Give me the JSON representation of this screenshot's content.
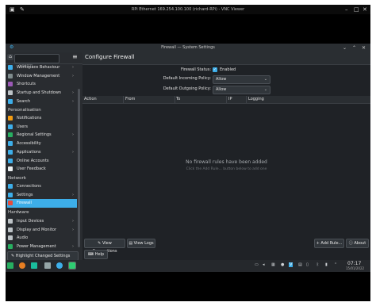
{
  "vnc": {
    "title": "RPi Ethernet 169.254.100.100 (richard-RPi) - VNC Viewer",
    "ctrl_min": "–",
    "ctrl_max": "□",
    "ctrl_close": "✕"
  },
  "window": {
    "title": "Firewall — System Settings",
    "ctrl_min": "⌄",
    "ctrl_max": "⌃",
    "ctrl_close": "✕"
  },
  "sidebar": {
    "search_placeholder": "Search...",
    "items_top": [
      {
        "label": "Workspace Behaviour",
        "chev": "›",
        "color": "#3daee9"
      },
      {
        "label": "Window Management",
        "chev": "›",
        "color": "#7f8c8d"
      },
      {
        "label": "Shortcuts",
        "chev": "",
        "color": "#9b59b6"
      },
      {
        "label": "Startup and Shutdown",
        "chev": "›",
        "color": "#bdc3c7"
      },
      {
        "label": "Search",
        "chev": "›",
        "color": "#3daee9"
      }
    ],
    "section_personalisation": "Personalisation",
    "items_personal": [
      {
        "label": "Notifications",
        "chev": "",
        "color": "#f39c12"
      },
      {
        "label": "Users",
        "chev": "",
        "color": "#3daee9"
      },
      {
        "label": "Regional Settings",
        "chev": "›",
        "color": "#27ae60"
      },
      {
        "label": "Accessibility",
        "chev": "",
        "color": "#3daee9"
      },
      {
        "label": "Applications",
        "chev": "›",
        "color": "#3daee9"
      },
      {
        "label": "Online Accounts",
        "chev": "",
        "color": "#3daee9"
      },
      {
        "label": "User Feedback",
        "chev": "",
        "color": "#ecf0f1"
      }
    ],
    "section_network": "Network",
    "items_network": [
      {
        "label": "Connections",
        "chev": "",
        "color": "#3daee9"
      },
      {
        "label": "Settings",
        "chev": "›",
        "color": "#3daee9"
      },
      {
        "label": "Firewall",
        "chev": "",
        "color": "#e74c3c"
      }
    ],
    "section_hardware": "Hardware",
    "items_hardware": [
      {
        "label": "Input Devices",
        "chev": "›",
        "color": "#bdc3c7"
      },
      {
        "label": "Display and Monitor",
        "chev": "›",
        "color": "#bdc3c7"
      },
      {
        "label": "Audio",
        "chev": "",
        "color": "#bdc3c7"
      },
      {
        "label": "Power Management",
        "chev": "›",
        "color": "#27ae60"
      }
    ],
    "highlight_label": "Highlight Changed Settings"
  },
  "main": {
    "title": "Configure Firewall",
    "status_label": "Firewall Status:",
    "status_value": "Enabled",
    "incoming_label": "Default Incoming Policy:",
    "incoming_value": "Allow",
    "outgoing_label": "Default Outgoing Policy:",
    "outgoing_value": "Allow",
    "columns": [
      "Action",
      "From",
      "To",
      "IP",
      "Logging"
    ],
    "empty_title": "No firewall rules have been added",
    "empty_hint": "Click the Add Rule... button below to add one",
    "view_connections": "View Connections",
    "view_logs": "View Logs",
    "add_rule": "Add Rule...",
    "about": "About",
    "help": "Help"
  },
  "taskbar": {
    "time": "07:17",
    "date": "15/01/2022"
  }
}
